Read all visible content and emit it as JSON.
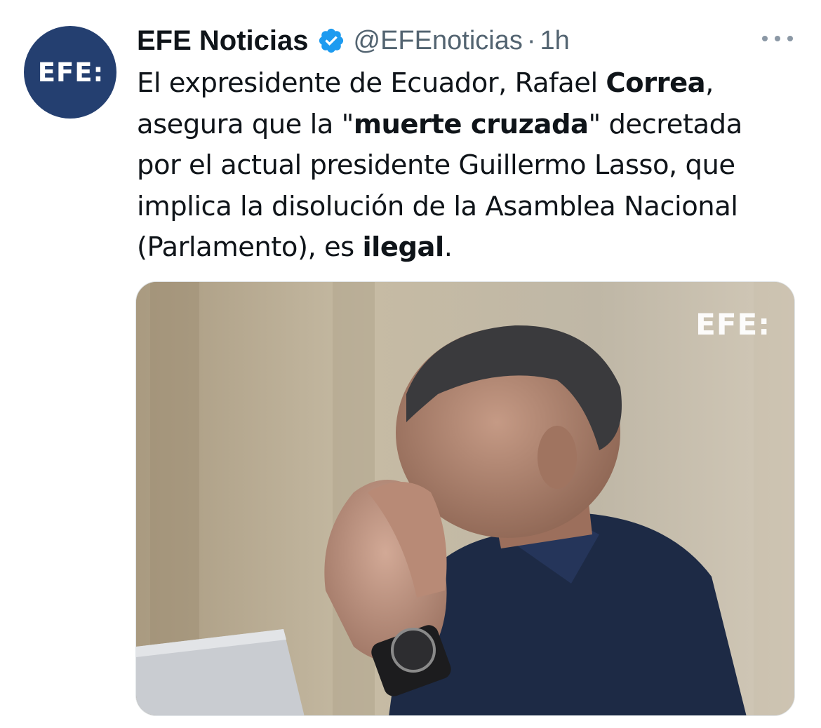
{
  "account": {
    "display_name": "EFE Noticias",
    "handle": "@EFEnoticias",
    "separator": "·",
    "time": "1h",
    "avatar_text": "EFE:",
    "verified_icon": "verified-badge-icon",
    "more_icon": "more-dots-icon"
  },
  "tweet": {
    "lines": [
      [
        {
          "t": "El expresidente de Ecuador, Rafael "
        },
        {
          "t": "Correa",
          "b": true
        },
        {
          "t": ","
        }
      ],
      [
        {
          "t": "asegura que la \""
        },
        {
          "t": "muerte cruzada",
          "b": true
        },
        {
          "t": "\" decretada"
        }
      ],
      [
        {
          "t": "por el actual presidente Guillermo Lasso, que"
        }
      ],
      [
        {
          "t": "implica la disolución de la Asamblea Nacional"
        }
      ],
      [
        {
          "t": "(Parlamento), es "
        },
        {
          "t": "ilegal",
          "b": true
        },
        {
          "t": "."
        }
      ]
    ]
  },
  "media": {
    "watermark": "EFE:"
  },
  "colors": {
    "avatar_bg": "#243f70",
    "verified_blue": "#1d9bf0",
    "secondary_text": "#536471",
    "primary_text": "#0f1419"
  }
}
